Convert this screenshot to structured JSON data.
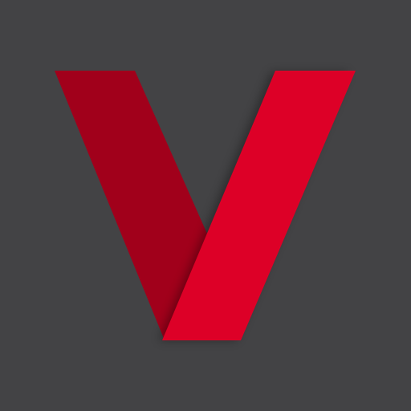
{
  "icon": {
    "name": "v-logo-icon",
    "background_color": "#434345",
    "left_stroke_color": "#A1001B",
    "right_stroke_color": "#DD0027",
    "shadow_color": "#000000"
  }
}
